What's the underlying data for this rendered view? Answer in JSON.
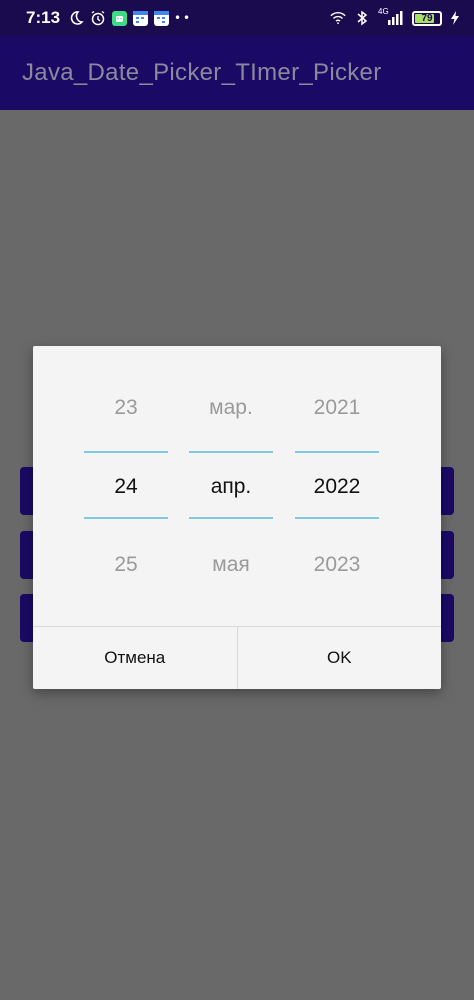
{
  "status_bar": {
    "time": "7:13",
    "network": "4G",
    "battery": "79",
    "battery_level": 0.79
  },
  "app_bar": {
    "title": "Java_Date_Picker_TImer_Picker"
  },
  "date_picker": {
    "day": {
      "prev": "23",
      "selected": "24",
      "next": "25"
    },
    "month": {
      "prev": "мар.",
      "selected": "апр.",
      "next": "мая"
    },
    "year": {
      "prev": "2021",
      "selected": "2022",
      "next": "2023"
    },
    "cancel_label": "Отмена",
    "ok_label": "OK"
  },
  "colors": {
    "app_bar": "#1b0966",
    "status_bar": "#1a0a4e",
    "scrim": "#696969",
    "picker_divider": "#7ec8ea",
    "dialog_bg": "#f4f4f4"
  }
}
